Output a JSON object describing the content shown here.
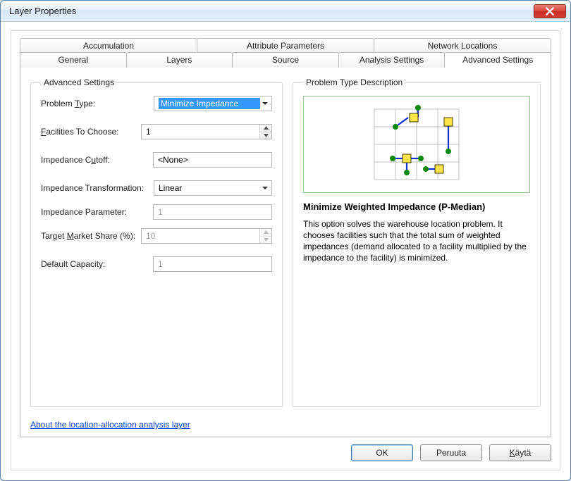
{
  "window": {
    "title": "Layer Properties"
  },
  "tabs": {
    "row1": [
      {
        "label": "Accumulation"
      },
      {
        "label": "Attribute Parameters"
      },
      {
        "label": "Network Locations"
      }
    ],
    "row2": [
      {
        "label": "General"
      },
      {
        "label": "Layers"
      },
      {
        "label": "Source"
      },
      {
        "label": "Analysis Settings"
      },
      {
        "label": "Advanced Settings",
        "active": true
      }
    ]
  },
  "panel": {
    "advanced_legend": "Advanced Settings",
    "desc_legend": "Problem Type Description",
    "fields": {
      "problem_type": {
        "label_pre": "Problem ",
        "label_ul": "T",
        "label_post": "ype:",
        "value": "Minimize Impedance"
      },
      "facilities": {
        "label_ul": "F",
        "label_post": "acilities To Choose:",
        "value": "1"
      },
      "cutoff": {
        "label_pre": "Impedance C",
        "label_ul": "u",
        "label_post": "toff:",
        "value": "<None>"
      },
      "transformation": {
        "label": "Impedance Transformation:",
        "value": "Linear"
      },
      "parameter": {
        "label": "Impedance Parameter:",
        "value": "1"
      },
      "market_share": {
        "label_pre": "Target ",
        "label_ul": "M",
        "label_post": "arket Share (%):",
        "value": "10"
      },
      "capacity": {
        "label": "Default Capacity:",
        "value": "1"
      }
    },
    "description": {
      "title": "Minimize Weighted Impedance (P-Median)",
      "body": "This option solves the warehouse location problem. It chooses facilities such that the total sum of weighted impedances (demand allocated to a facility multiplied by the impedance to the facility) is minimized."
    },
    "help_link": "About the location-allocation analysis layer"
  },
  "buttons": {
    "ok": "OK",
    "cancel": "Peruuta",
    "apply_ul": "K",
    "apply_post": "äytä"
  }
}
